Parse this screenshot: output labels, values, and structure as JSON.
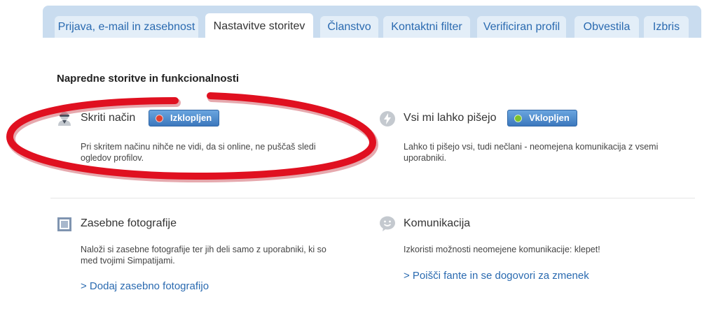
{
  "tabs": [
    {
      "label": "Prijava, e-mail in zasebnost",
      "active": false
    },
    {
      "label": "Nastavitve storitev",
      "active": true
    },
    {
      "label": "Članstvo",
      "active": false
    },
    {
      "label": "Kontaktni filter",
      "active": false
    },
    {
      "label": "Verificiran profil",
      "active": false
    },
    {
      "label": "Obvestila",
      "active": false
    },
    {
      "label": "Izbris",
      "active": false
    }
  ],
  "section": {
    "title": "Napredne storitve in funkcionalnosti"
  },
  "hidden_mode": {
    "title": "Skriti način",
    "toggle_label": "Izklopljen",
    "toggle_state": "off",
    "desc_line1": "Pri skritem načinu nihče ne vidi, da si online, ne puščaš sledi",
    "desc_line2": "ogledov profilov.",
    "icon": "incognito-icon"
  },
  "anyone_write": {
    "title": "Vsi mi lahko pišejo",
    "toggle_label": "Vklopljen",
    "toggle_state": "on",
    "desc_line1": "Lahko ti pišejo vsi, tudi nečlani - neomejena komunikacija z vsemi",
    "desc_line2": "uporabniki.",
    "icon": "lightning-icon"
  },
  "private_photos": {
    "title": "Zasebne fotografije",
    "desc_line1": "Naloži si zasebne fotografije ter jih deli samo z uporabniki, ki so",
    "desc_line2": "med tvojimi Simpatijami.",
    "link": "> Dodaj zasebno fotografijo",
    "icon": "photo-frame-icon"
  },
  "communication": {
    "title": "Komunikacija",
    "desc_line1": "Izkoristi možnosti neomejene komunikacije: klepet!",
    "link": "> Poišči fante in se dogovori za zmenek",
    "icon": "smiley-chat-icon"
  },
  "colors": {
    "tabbar_bg": "#c9dcef",
    "tab_bg": "#e3eef8",
    "link": "#2a6ab0",
    "toggle_blue": "#3c78bd",
    "off_dot": "#e2402f",
    "on_dot": "#7ec22c",
    "annotation_red": "#e01020"
  }
}
